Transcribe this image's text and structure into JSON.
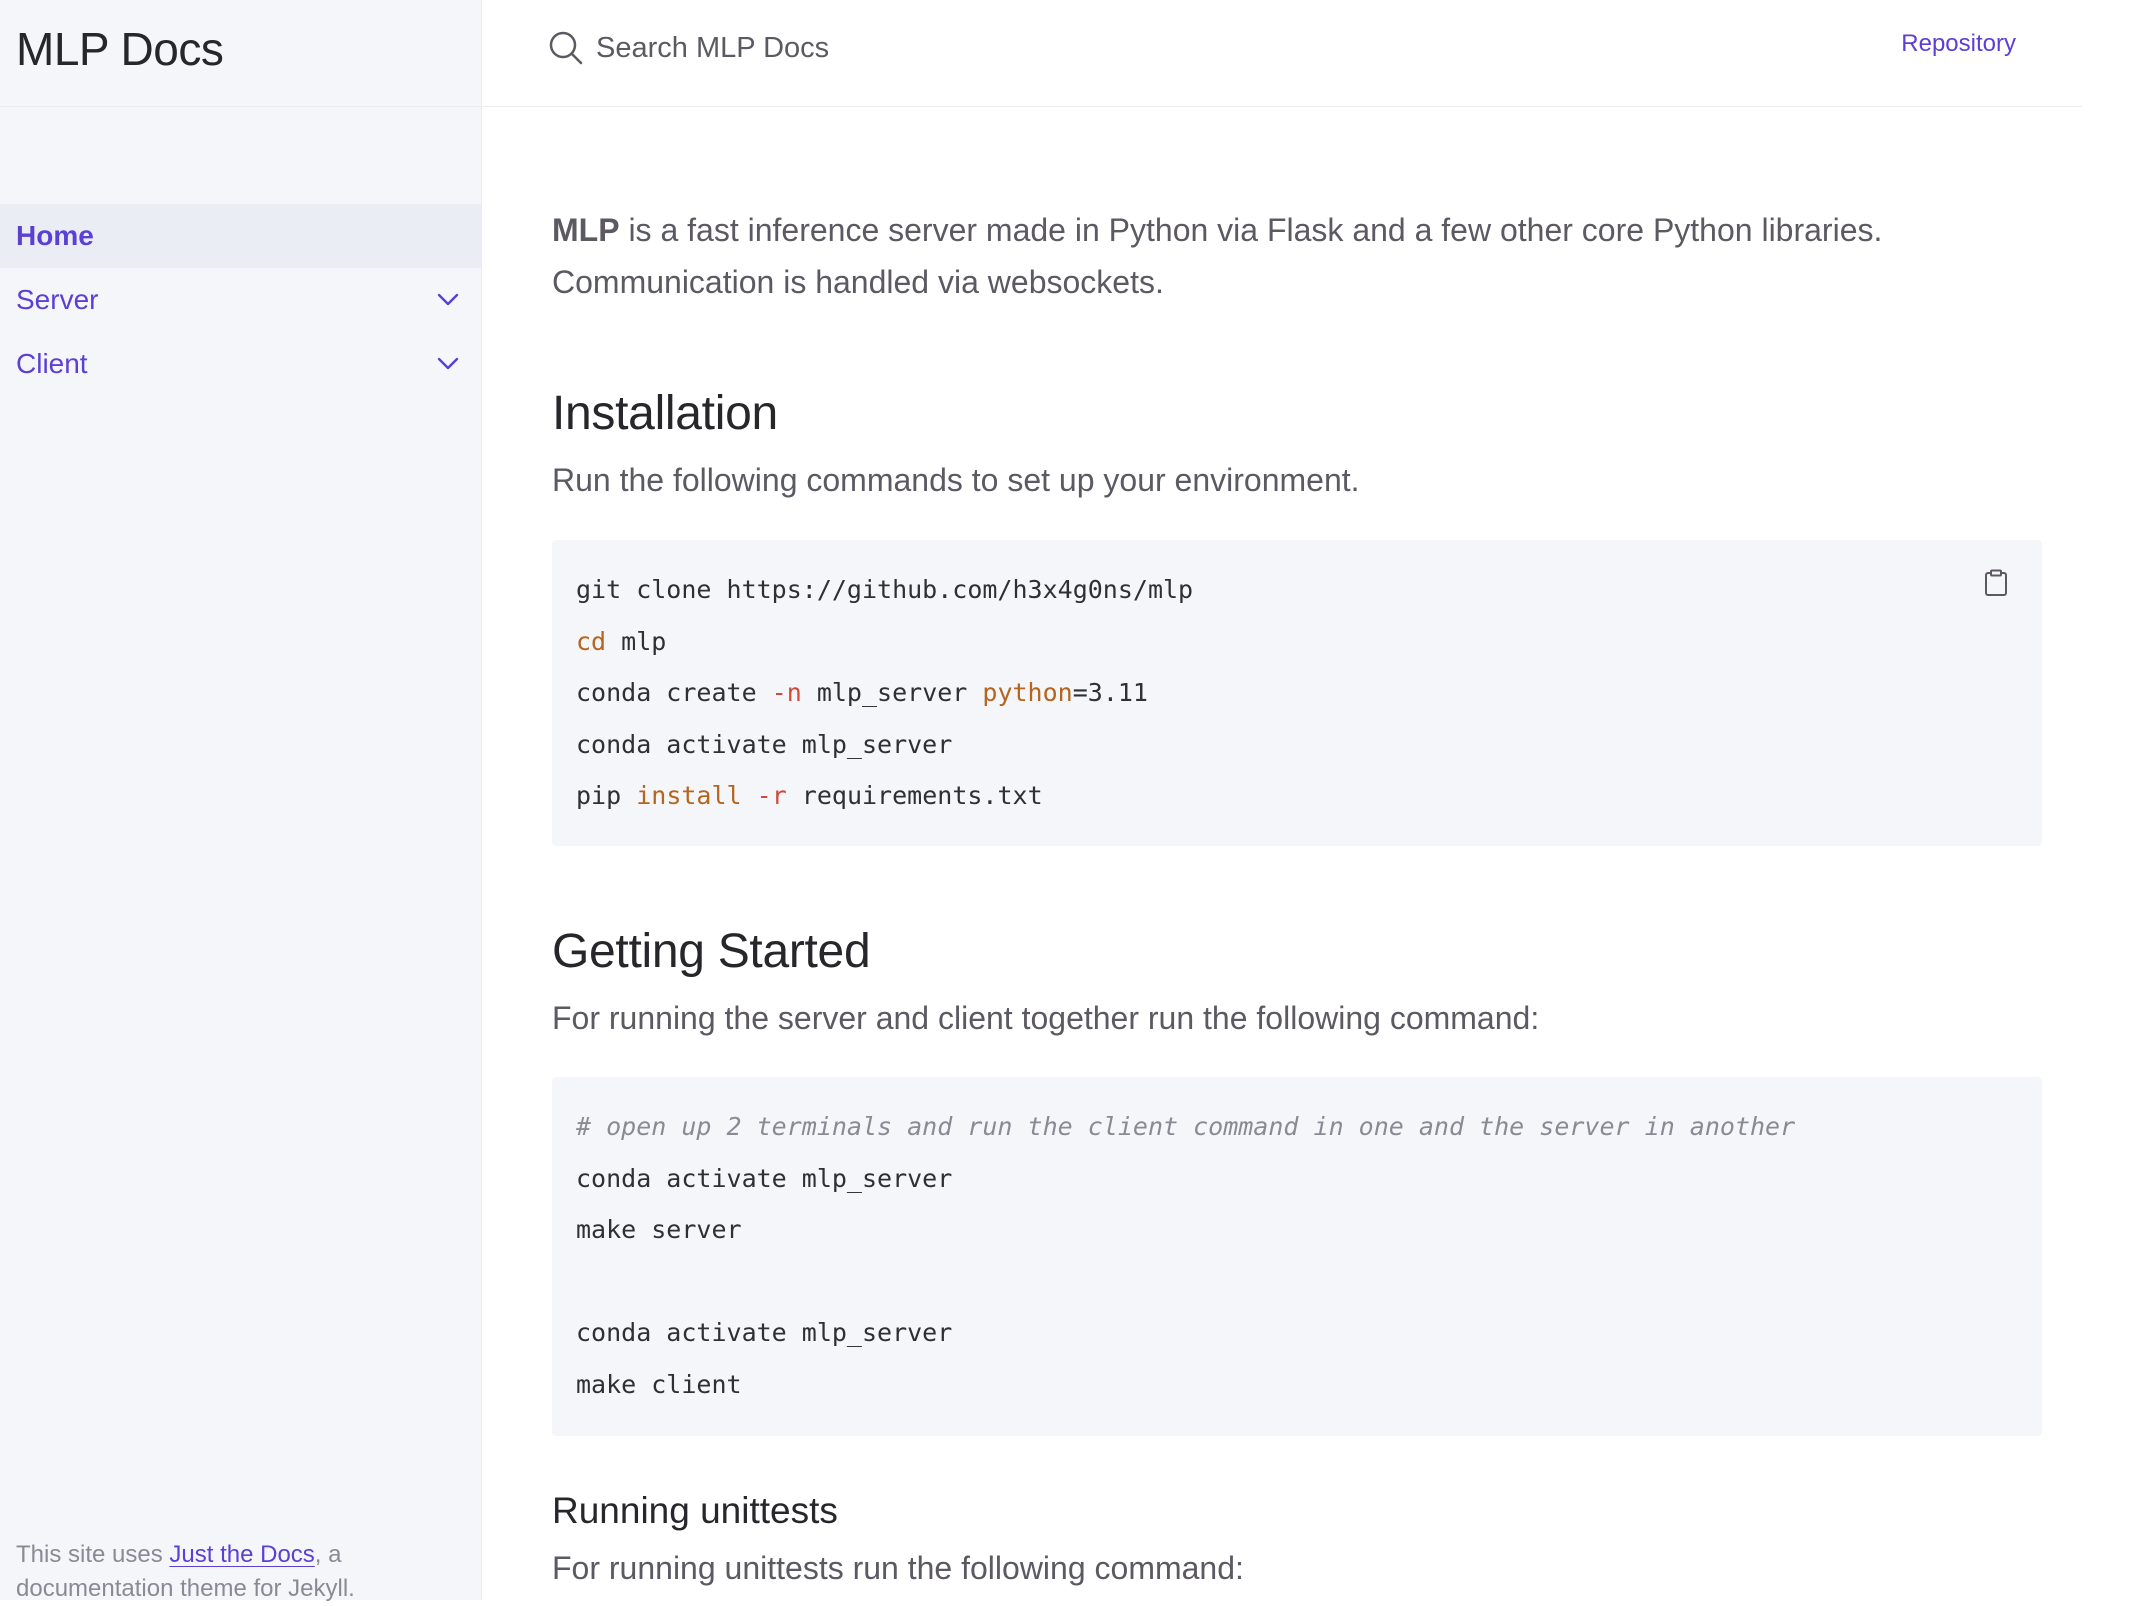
{
  "sidebar": {
    "site_title": "MLP Docs",
    "nav": [
      {
        "label": "Home",
        "active": true,
        "expandable": false
      },
      {
        "label": "Server",
        "active": false,
        "expandable": true
      },
      {
        "label": "Client",
        "active": false,
        "expandable": true
      }
    ],
    "footer": {
      "prefix": "This site uses ",
      "link_text": "Just the Docs",
      "suffix": ", a documentation theme for Jekyll."
    }
  },
  "header": {
    "search_placeholder": "Search MLP Docs",
    "aux_link": "Repository"
  },
  "main": {
    "intro_bold": "MLP",
    "intro_text": " is a fast inference server made in Python via Flask and a few other core Python libraries. Communication is handled via websockets.",
    "installation": {
      "heading": "Installation",
      "description": "Run the following commands to set up your environment.",
      "code": {
        "line1": "git clone https://github.com/h3x4g0ns/mlp",
        "line2_kw": "cd",
        "line2_rest": " mlp",
        "line3_a": "conda create ",
        "line3_flag": "-n",
        "line3_b": " mlp_server ",
        "line3_kw": "python",
        "line3_c": "=3.11",
        "line4": "conda activate mlp_server",
        "line5_a": "pip ",
        "line5_kw": "install",
        "line5_sp": " ",
        "line5_flag": "-r",
        "line5_b": " requirements.txt"
      }
    },
    "getting_started": {
      "heading": "Getting Started",
      "description": "For running the server and client together run the following command:",
      "code": {
        "comment": "# open up 2 terminals and run the client command in one and the server in another",
        "line1": "conda activate mlp_server",
        "line2": "make server",
        "line3": "",
        "line4": "conda activate mlp_server",
        "line5": "make client"
      }
    },
    "unittests": {
      "heading": "Running unittests",
      "description": "For running unittests run the following command:"
    }
  },
  "colors": {
    "accent": "#5c3fd4",
    "sidebar_bg": "#f5f6fa",
    "code_bg": "#f5f6fa",
    "text": "#5c5962",
    "heading": "#27262b"
  }
}
